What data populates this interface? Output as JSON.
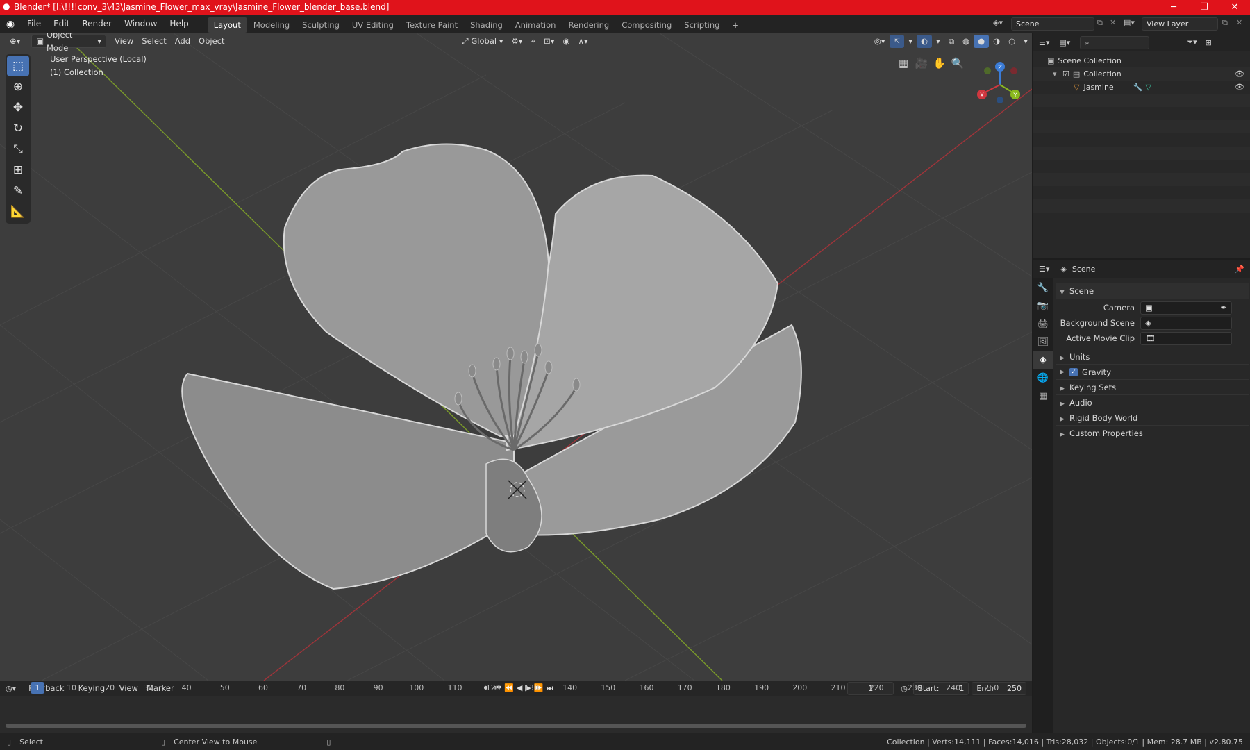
{
  "titlebar": {
    "title": "Blender* [I:\\!!!!conv_3\\43\\Jasmine_Flower_max_vray\\Jasmine_Flower_blender_base.blend]"
  },
  "menu": {
    "items": [
      "File",
      "Edit",
      "Render",
      "Window",
      "Help"
    ]
  },
  "workspaces": [
    "Layout",
    "Modeling",
    "Sculpting",
    "UV Editing",
    "Texture Paint",
    "Shading",
    "Animation",
    "Rendering",
    "Compositing",
    "Scripting"
  ],
  "scene_field": "Scene",
  "view_layer_field": "View Layer",
  "viewport": {
    "mode": "Object Mode",
    "menus": [
      "View",
      "Select",
      "Add",
      "Object"
    ],
    "orientation": "Global",
    "overlay_line1": "User Perspective (Local)",
    "overlay_line2": "(1) Collection",
    "gizmo": {
      "x": "X",
      "y": "Y",
      "z": "Z"
    }
  },
  "outliner": {
    "root": "Scene Collection",
    "collection": "Collection",
    "object": "Jasmine"
  },
  "properties": {
    "header": "Scene",
    "section": "Scene",
    "camera_label": "Camera",
    "background_scene_label": "Background Scene",
    "active_movie_clip_label": "Active Movie Clip",
    "panels": [
      "Units",
      "Gravity",
      "Keying Sets",
      "Audio",
      "Rigid Body World",
      "Custom Properties"
    ],
    "gravity_checked": true
  },
  "timeline": {
    "menus": [
      "Playback",
      "Keying",
      "View",
      "Marker"
    ],
    "current_frame": "1",
    "start_label": "Start:",
    "start": "1",
    "end_label": "End:",
    "end": "250",
    "ticks": [
      "1",
      "10",
      "20",
      "30",
      "40",
      "50",
      "60",
      "70",
      "80",
      "90",
      "100",
      "110",
      "120",
      "130",
      "140",
      "150",
      "160",
      "170",
      "180",
      "190",
      "200",
      "210",
      "220",
      "230",
      "240",
      "250"
    ]
  },
  "status": {
    "select": "Select",
    "center_view": "Center View to Mouse",
    "stats": "Collection | Verts:14,111 | Faces:14,016 | Tris:28,032 | Objects:0/1 | Mem: 28.7 MB | v2.80.75"
  },
  "colors": {
    "accent": "#4772b3",
    "titlebar": "#e0131b",
    "x_axis": "#d0373f",
    "y_axis": "#8ab81e",
    "z_axis": "#3b7cd6"
  }
}
